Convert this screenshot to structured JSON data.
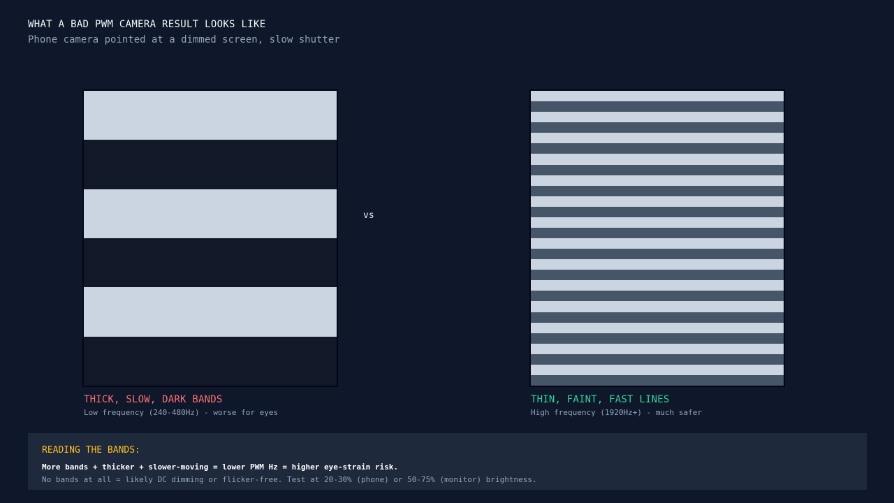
{
  "header": {
    "title": "WHAT A BAD PWM CAMERA RESULT LOOKS LIKE",
    "subtitle": "Phone camera pointed at a dimmed screen, slow shutter"
  },
  "comparison": {
    "separator": "vs",
    "left": {
      "title": "THICK, SLOW, DARK BANDS",
      "subtitle": "Low frequency (240-480Hz) - worse for eyes",
      "title_color": "#f87171",
      "band_count": 6,
      "light_color": "#cbd5e1",
      "dark_color": "#111827"
    },
    "right": {
      "title": "THIN, FAINT, FAST LINES",
      "subtitle": "High frequency (1920Hz+) - much safer",
      "title_color": "#34d399",
      "band_count": 28,
      "light_color": "#cbd5e1",
      "dark_color": "#475569"
    }
  },
  "info": {
    "title": "READING THE BANDS:",
    "line1": "More bands + thicker + slower-moving = lower PWM Hz = higher eye-strain risk.",
    "line2": "No bands at all = likely DC dimming or flicker-free. Test at 20-30% (phone) or 50-75% (monitor) brightness."
  }
}
